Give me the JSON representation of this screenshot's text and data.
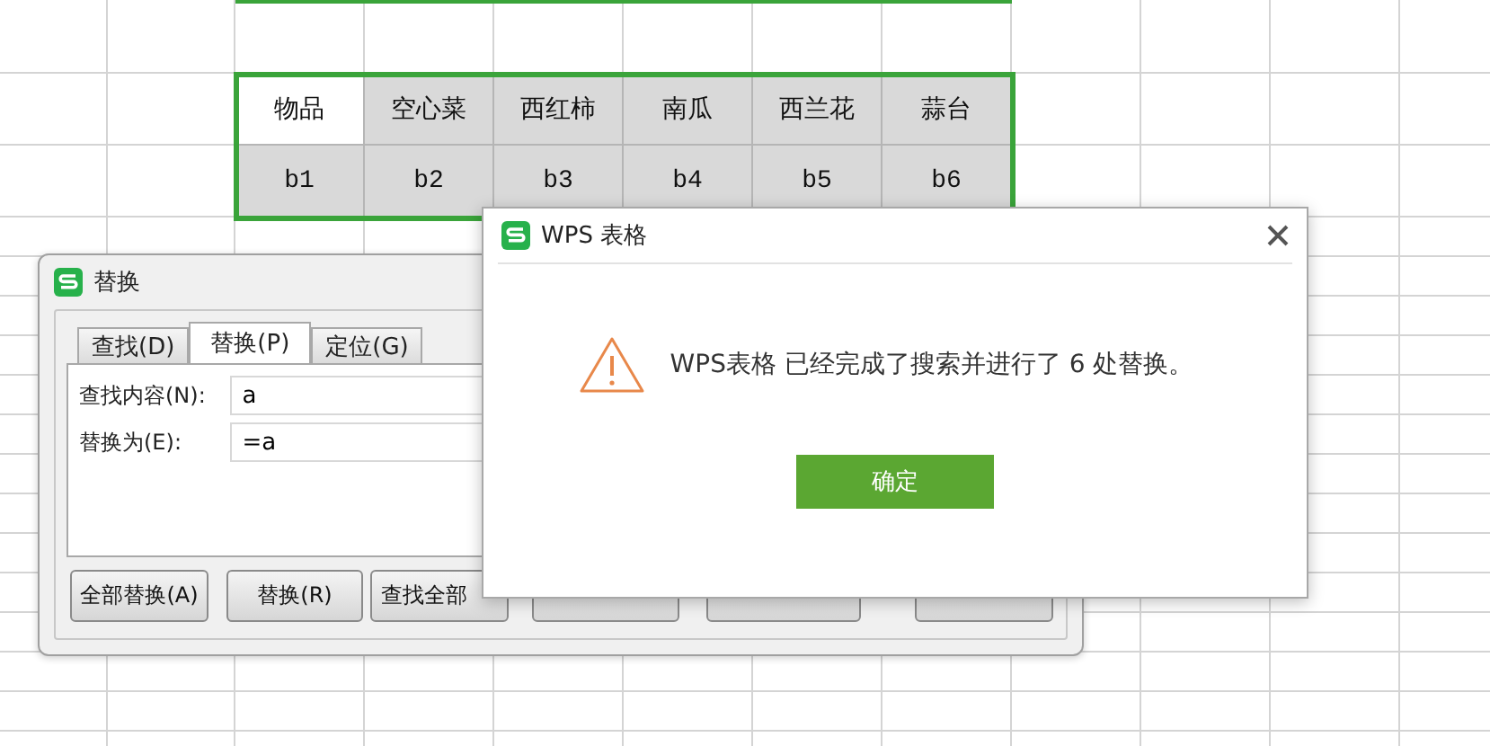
{
  "spreadsheet": {
    "rows": [
      [
        {
          "text": "物品",
          "selected": true
        },
        {
          "text": "空心菜",
          "selected": false
        },
        {
          "text": "西红柿",
          "selected": false
        },
        {
          "text": "南瓜",
          "selected": false
        },
        {
          "text": "西兰花",
          "selected": false
        },
        {
          "text": "蒜台",
          "selected": false
        }
      ],
      [
        {
          "text": "b1",
          "selected": false
        },
        {
          "text": "b2",
          "selected": false
        },
        {
          "text": "b3",
          "selected": false
        },
        {
          "text": "b4",
          "selected": false
        },
        {
          "text": "b5",
          "selected": false
        },
        {
          "text": "b6",
          "selected": false
        }
      ]
    ]
  },
  "replace_dialog": {
    "title": "替换",
    "tabs": [
      {
        "label": "查找(D)",
        "selected": false
      },
      {
        "label": "替换(P)",
        "selected": true
      },
      {
        "label": "定位(G)",
        "selected": false
      }
    ],
    "fields": [
      {
        "label": "查找内容(N):",
        "value": "a"
      },
      {
        "label": "替换为(E):",
        "value": "=a"
      }
    ],
    "buttons": [
      {
        "kind": "button",
        "label": "全部替换(A)"
      },
      {
        "kind": "button",
        "label": "替换(R)"
      },
      {
        "kind": "button",
        "label": "查找全部"
      },
      {
        "kind": "button"
      },
      {
        "kind": "button"
      },
      {
        "kind": "button"
      }
    ]
  },
  "message_dialog": {
    "title": "WPS 表格",
    "message": "WPS表格 已经完成了搜索并进行了 6 处替换。",
    "button": "确定"
  }
}
